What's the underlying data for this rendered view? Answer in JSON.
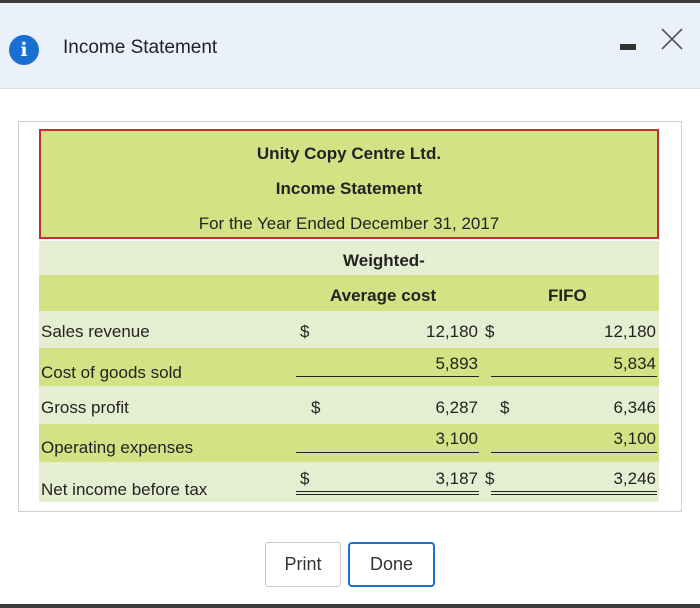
{
  "window": {
    "title": "Income Statement",
    "icons": {
      "info": "info-icon",
      "minimize": "minimize-icon",
      "close": "close-icon"
    },
    "colors": {
      "accent": "#1a6fd1",
      "header_fill": "#d4e286",
      "row_alt_fill": "#e6eed2",
      "header_border": "#c22f2f"
    }
  },
  "statement": {
    "company": "Unity Copy Centre Ltd.",
    "name": "Income Statement",
    "period": "For the Year Ended December 31, 2017",
    "col_wac_line1": "Weighted-",
    "col_wac_line2": "Average cost",
    "col_fifo": "FIFO",
    "rows": [
      {
        "label": "Sales revenue",
        "wac_sym": "$",
        "wac": "12,180",
        "fifo_sym": "$",
        "fifo": "12,180"
      },
      {
        "label": "Cost of goods sold",
        "wac_sym": "",
        "wac": "5,893",
        "fifo_sym": "",
        "fifo": "5,834"
      },
      {
        "label": "Gross profit",
        "wac_sym": "$",
        "wac": "6,287",
        "fifo_sym": "$",
        "fifo": "6,346"
      },
      {
        "label": "Operating expenses",
        "wac_sym": "",
        "wac": "3,100",
        "fifo_sym": "",
        "fifo": "3,100"
      },
      {
        "label": "Net income before tax",
        "wac_sym": "$",
        "wac": "3,187",
        "fifo_sym": "$",
        "fifo": "3,246"
      }
    ]
  },
  "buttons": {
    "print": "Print",
    "done": "Done"
  }
}
